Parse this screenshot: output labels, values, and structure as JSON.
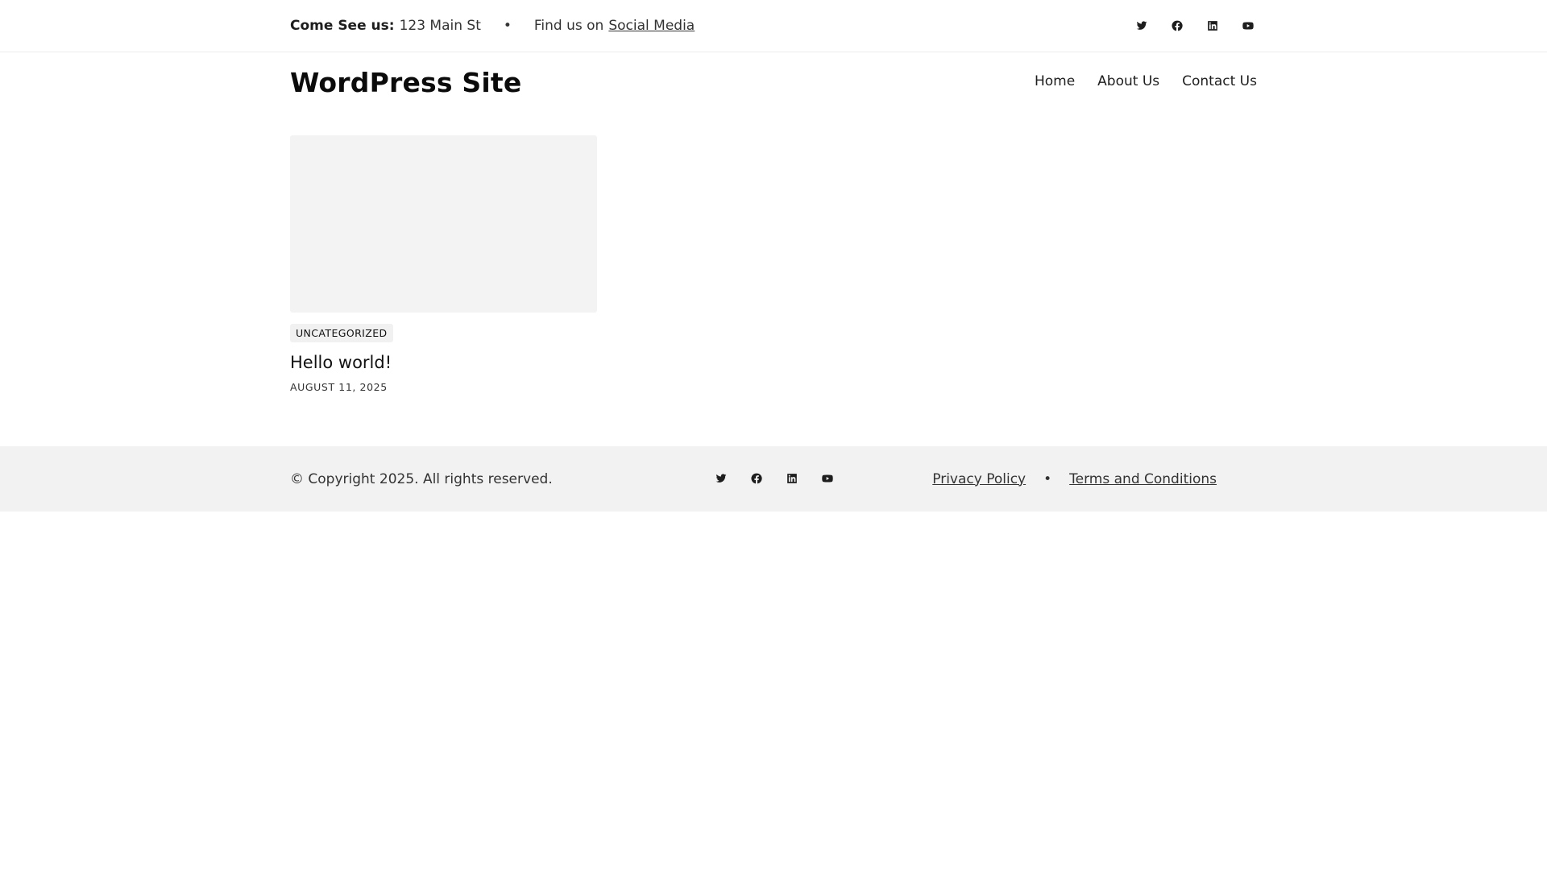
{
  "topbar": {
    "come_label": "Come See us:",
    "address": "123 Main St",
    "separator": "•",
    "find_text": "Find us on",
    "social_link": "Social Media",
    "social_icons": [
      "twitter-icon",
      "facebook-icon",
      "linkedin-icon",
      "youtube-icon"
    ]
  },
  "header": {
    "site_title": "WordPress Site",
    "nav": [
      "Home",
      "About Us",
      "Contact Us"
    ]
  },
  "posts": [
    {
      "category": "UNCATEGORIZED",
      "title": "Hello world!",
      "date": "AUGUST 11, 2025"
    }
  ],
  "footer": {
    "copyright": "© Copyright 2025. All rights reserved.",
    "links": [
      "Privacy Policy",
      "Terms and Conditions"
    ],
    "separator": "•",
    "social_icons": [
      "twitter-icon",
      "facebook-icon",
      "linkedin-icon",
      "youtube-icon"
    ]
  }
}
